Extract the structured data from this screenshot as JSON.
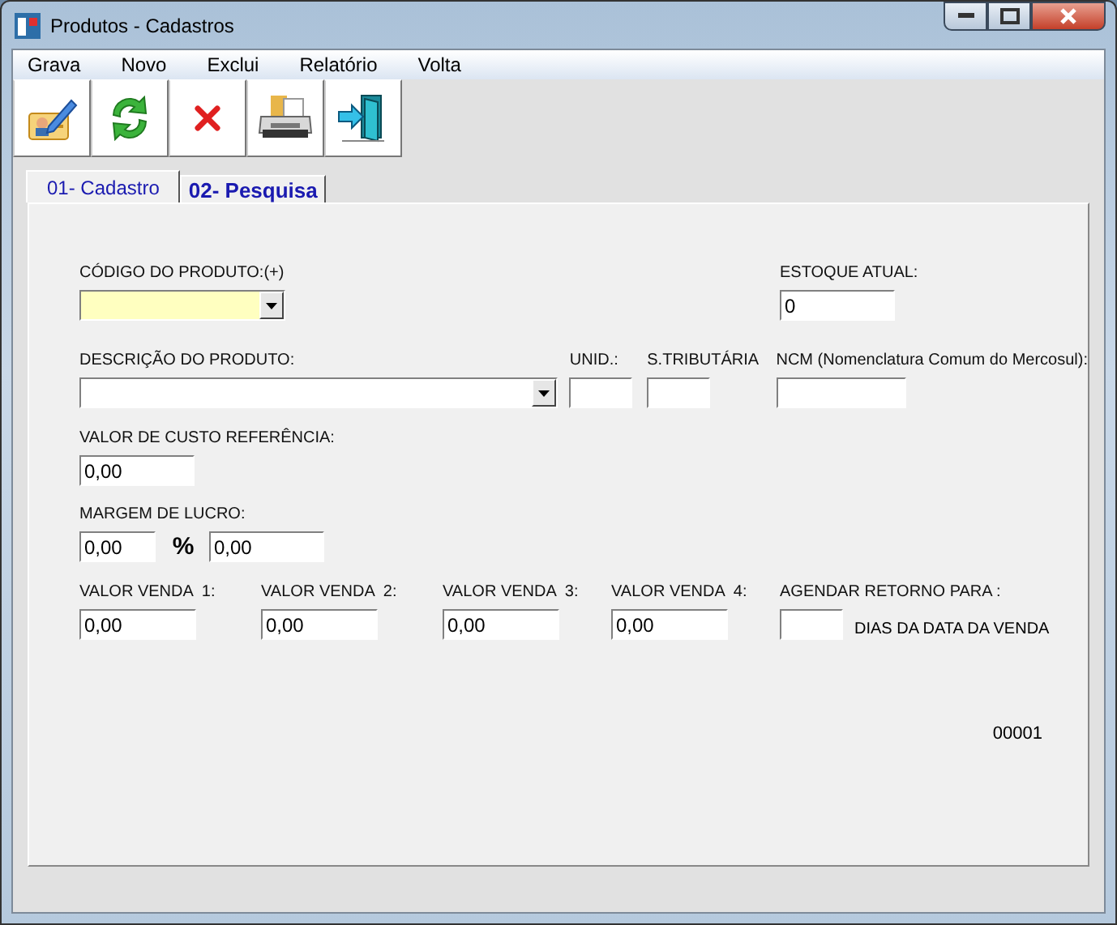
{
  "window": {
    "title": "Produtos - Cadastros"
  },
  "menu": [
    {
      "label": "Grava"
    },
    {
      "label": "Novo"
    },
    {
      "label": "Exclui"
    },
    {
      "label": "Relatório"
    },
    {
      "label": "Volta"
    }
  ],
  "toolbar": [
    {
      "kind": "edit"
    },
    {
      "kind": "refresh"
    },
    {
      "kind": "delete"
    },
    {
      "kind": "print"
    },
    {
      "kind": "exit"
    }
  ],
  "tabs": [
    {
      "label": "01- Cadastro",
      "selected": true
    },
    {
      "label": "02- Pesquisa",
      "selected": false
    }
  ],
  "form": {
    "rows": [
      {
        "fields": [
          {
            "kind": "combo",
            "label": "CÓDIGO DO PRODUTO:(+)",
            "focused": true
          },
          {
            "kind": "text",
            "label": "ESTOQUE ATUAL:",
            "value": "0"
          }
        ]
      },
      {
        "fields": [
          {
            "kind": "combo",
            "label": "DESCRIÇÃO DO PRODUTO:",
            "focused": false
          },
          {
            "kind": "text",
            "label": "UNID.:"
          },
          {
            "kind": "text",
            "label": "S.TRIBUTÁRIA"
          },
          {
            "kind": "text",
            "label": "NCM (Nomenclatura Comum do Mercosul):"
          }
        ]
      },
      {
        "fields": [
          {
            "kind": "text",
            "label": "VALOR DE CUSTO REFERÊNCIA:",
            "value": "0,00"
          }
        ]
      },
      {
        "label": "MARGEM DE LUCRO:",
        "fields": [
          {
            "kind": "text",
            "value": "0,00"
          },
          {
            "kind": "sign",
            "text": "%"
          },
          {
            "kind": "text",
            "value": "0,00"
          }
        ]
      },
      {
        "fields": [
          {
            "kind": "text",
            "label": "VALOR VENDA  1:",
            "value": "0,00"
          },
          {
            "kind": "text",
            "label": "VALOR VENDA  2:",
            "value": "0,00"
          },
          {
            "kind": "text",
            "label": "VALOR VENDA  3:",
            "value": "0,00"
          },
          {
            "kind": "text",
            "label": "VALOR VENDA  4:",
            "value": "0,00"
          },
          {
            "kind": "text",
            "label": "AGENDAR RETORNO PARA :",
            "suffix": "DIAS DA DATA DA VENDA"
          }
        ]
      }
    ]
  },
  "record_number": "00001"
}
